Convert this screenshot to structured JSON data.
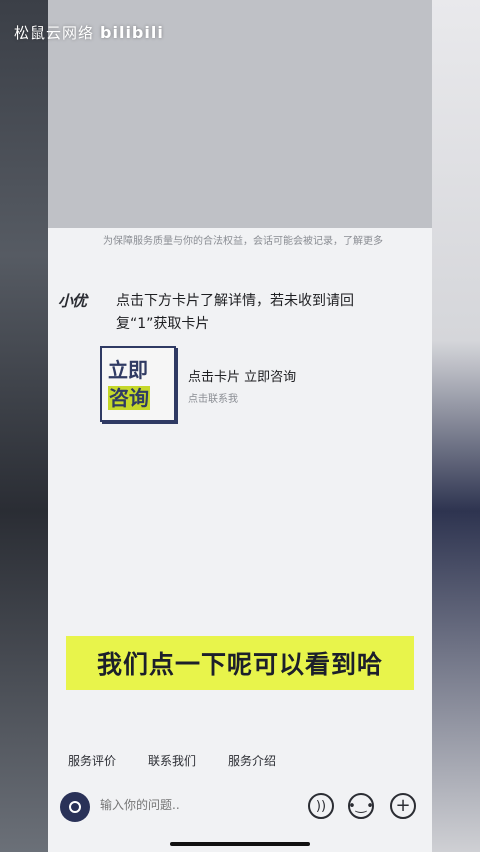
{
  "watermark": {
    "text": "松鼠云网络",
    "brand": "bilibili"
  },
  "chat": {
    "notice": "为保障服务质量与你的合法权益，会话可能会被记录，了解更多",
    "bot_name": "小优",
    "bot_message": "点击下方卡片了解详情，若未收到请回复“1”获取卡片",
    "card": {
      "thumb_line1": "立即",
      "thumb_line2": "咨询",
      "title": "点击卡片 立即咨询",
      "subtitle": "点击联系我"
    }
  },
  "video_subtitle": "我们点一下呢可以看到哈",
  "quick_links": [
    "服务评价",
    "联系我们",
    "服务介绍"
  ],
  "input": {
    "placeholder": "输入你的问题.."
  },
  "icons": {
    "camera": "camera-icon",
    "voice": "voice-icon",
    "emoji": "emoji-icon",
    "plus": "plus-icon"
  },
  "colors": {
    "subtitle_bg": "#e8f44b",
    "accent": "#2a3258"
  }
}
